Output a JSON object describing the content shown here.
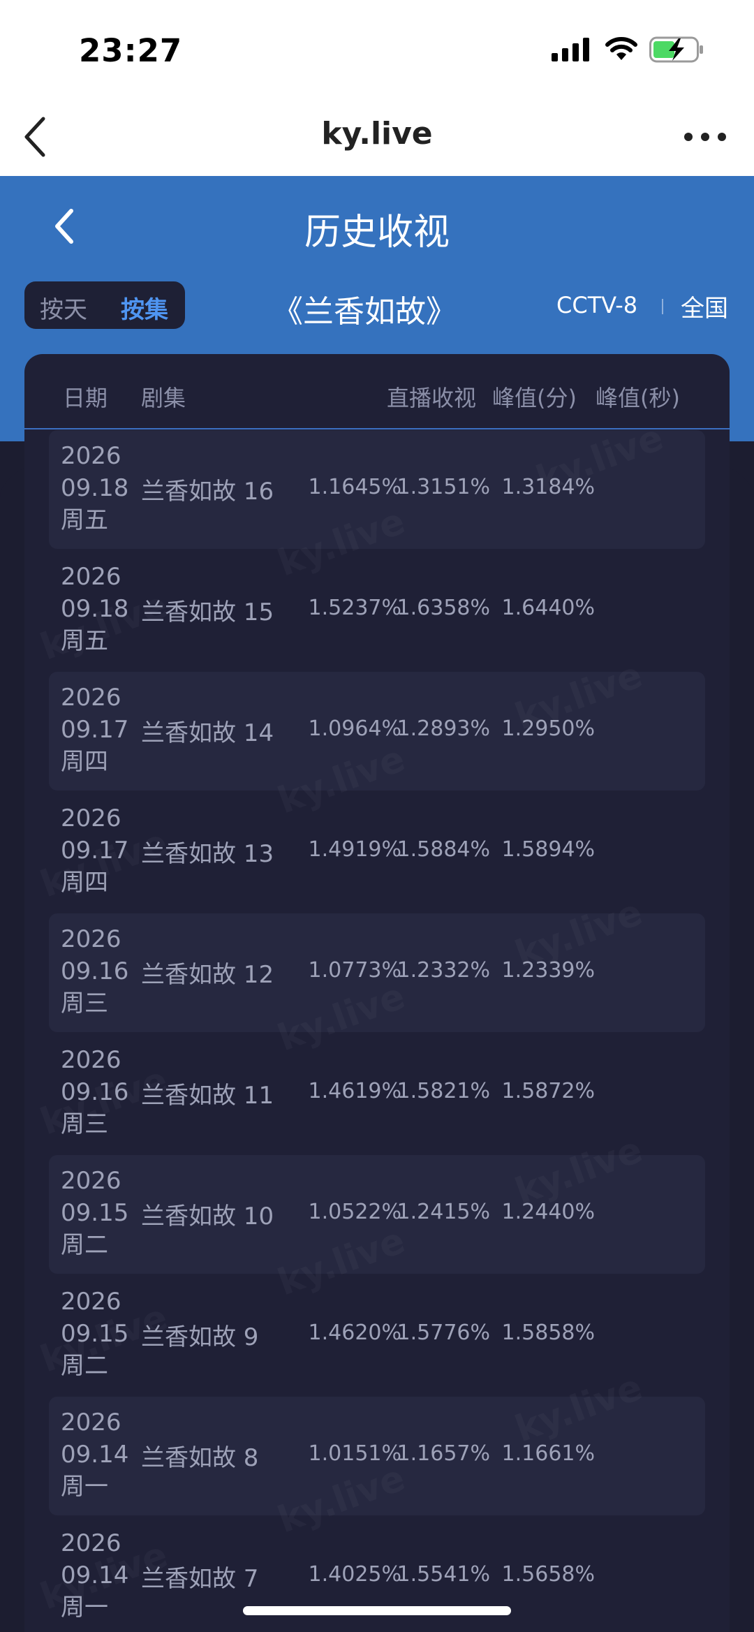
{
  "status_bar": {
    "time": "23:27"
  },
  "browser": {
    "title": "ky.live"
  },
  "header": {
    "title": "历史收视"
  },
  "segment": {
    "by_day": "按天",
    "by_episode": "按集"
  },
  "show_title": "《兰香如故》",
  "channel": "CCTV-8",
  "region": "全国",
  "table": {
    "columns": [
      "日期",
      "剧集",
      "直播收视",
      "峰值(分)",
      "峰值(秒)"
    ],
    "rows": [
      {
        "year": "2026",
        "date": "09.18",
        "weekday": "周五",
        "episode": "兰香如故 16",
        "live": "1.1645%",
        "peak_min": "1.3151%",
        "peak_sec": "1.3184%"
      },
      {
        "year": "2026",
        "date": "09.18",
        "weekday": "周五",
        "episode": "兰香如故 15",
        "live": "1.5237%",
        "peak_min": "1.6358%",
        "peak_sec": "1.6440%"
      },
      {
        "year": "2026",
        "date": "09.17",
        "weekday": "周四",
        "episode": "兰香如故 14",
        "live": "1.0964%",
        "peak_min": "1.2893%",
        "peak_sec": "1.2950%"
      },
      {
        "year": "2026",
        "date": "09.17",
        "weekday": "周四",
        "episode": "兰香如故 13",
        "live": "1.4919%",
        "peak_min": "1.5884%",
        "peak_sec": "1.5894%"
      },
      {
        "year": "2026",
        "date": "09.16",
        "weekday": "周三",
        "episode": "兰香如故 12",
        "live": "1.0773%",
        "peak_min": "1.2332%",
        "peak_sec": "1.2339%"
      },
      {
        "year": "2026",
        "date": "09.16",
        "weekday": "周三",
        "episode": "兰香如故 11",
        "live": "1.4619%",
        "peak_min": "1.5821%",
        "peak_sec": "1.5872%"
      },
      {
        "year": "2026",
        "date": "09.15",
        "weekday": "周二",
        "episode": "兰香如故 10",
        "live": "1.0522%",
        "peak_min": "1.2415%",
        "peak_sec": "1.2440%"
      },
      {
        "year": "2026",
        "date": "09.15",
        "weekday": "周二",
        "episode": "兰香如故 9",
        "live": "1.4620%",
        "peak_min": "1.5776%",
        "peak_sec": "1.5858%"
      },
      {
        "year": "2026",
        "date": "09.14",
        "weekday": "周一",
        "episode": "兰香如故 8",
        "live": "1.0151%",
        "peak_min": "1.1657%",
        "peak_sec": "1.1661%"
      },
      {
        "year": "2026",
        "date": "09.14",
        "weekday": "周一",
        "episode": "兰香如故 7",
        "live": "1.4025%",
        "peak_min": "1.5541%",
        "peak_sec": "1.5658%"
      }
    ]
  },
  "watermark": "ky.live",
  "colors": {
    "header_blue": "#3572be",
    "background": "#1c1d30",
    "accent": "#4f95f2"
  }
}
